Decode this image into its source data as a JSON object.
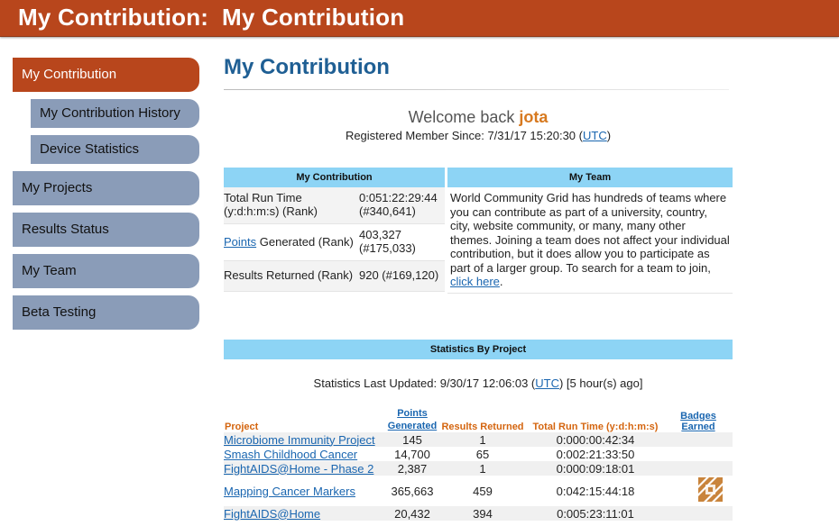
{
  "header": {
    "title": "My Contribution:  My Contribution"
  },
  "sidebar": {
    "items": [
      {
        "label": "My Contribution"
      },
      {
        "label": "My Contribution History"
      },
      {
        "label": "Device Statistics"
      },
      {
        "label": "My Projects"
      },
      {
        "label": "Results Status"
      },
      {
        "label": "My Team"
      },
      {
        "label": "Beta Testing"
      }
    ]
  },
  "main": {
    "title": "My Contribution",
    "welcome_prefix": "Welcome back ",
    "username": "jota",
    "since_prefix": "Registered Member Since: 7/31/17 15:20:30 (",
    "utc": "UTC",
    "since_suffix": ")"
  },
  "contribution": {
    "header": "My Contribution",
    "rows": [
      {
        "label": "Total Run Time (y:d:h:m:s) (Rank)",
        "value": "0:051:22:29:44 (#340,641)"
      },
      {
        "label_link": "Points",
        "label_rest": " Generated (Rank)",
        "value": "403,327 (#175,033)"
      },
      {
        "label": "Results Returned (Rank)",
        "value": "920 (#169,120)"
      }
    ]
  },
  "team": {
    "header": "My Team",
    "text": "World Community Grid has hundreds of teams where you can contribute as part of a university, country, city, website community, or many, many other themes. Joining a team does not affect your individual contribution, but it does allow you to participate as part of a larger group. To search for a team to join, ",
    "link": "click here",
    "end": "."
  },
  "stats": {
    "header": "Statistics By Project",
    "updated_prefix": "Statistics Last Updated: 9/30/17 12:06:03 (",
    "utc": "UTC",
    "updated_suffix": ") [5 hour(s) ago]",
    "columns": {
      "project": "Project",
      "points": "Points Generated",
      "results": "Results Returned",
      "runtime": "Total Run Time (y:d:h:m:s)",
      "badges": "Badges Earned"
    },
    "rows": [
      {
        "project": "Microbiome Immunity Project",
        "points": "145",
        "results": "1",
        "runtime": "0:000:00:42:34"
      },
      {
        "project": "Smash Childhood Cancer",
        "points": "14,700",
        "results": "65",
        "runtime": "0:002:21:33:50"
      },
      {
        "project": "FightAIDS@Home - Phase 2",
        "points": "2,387",
        "results": "1",
        "runtime": "0:000:09:18:01"
      },
      {
        "project": "Mapping Cancer Markers",
        "points": "365,663",
        "results": "459",
        "runtime": "0:042:15:44:18",
        "badge": "badge-icon"
      },
      {
        "project": "FightAIDS@Home",
        "points": "20,432",
        "results": "394",
        "runtime": "0:005:23:11:01"
      }
    ]
  },
  "colors": {
    "brand": "#b8461c",
    "nav": "#8a9cb8",
    "header_bg": "#8dd4f5",
    "title": "#1f5f94",
    "accent": "#d4650f"
  }
}
